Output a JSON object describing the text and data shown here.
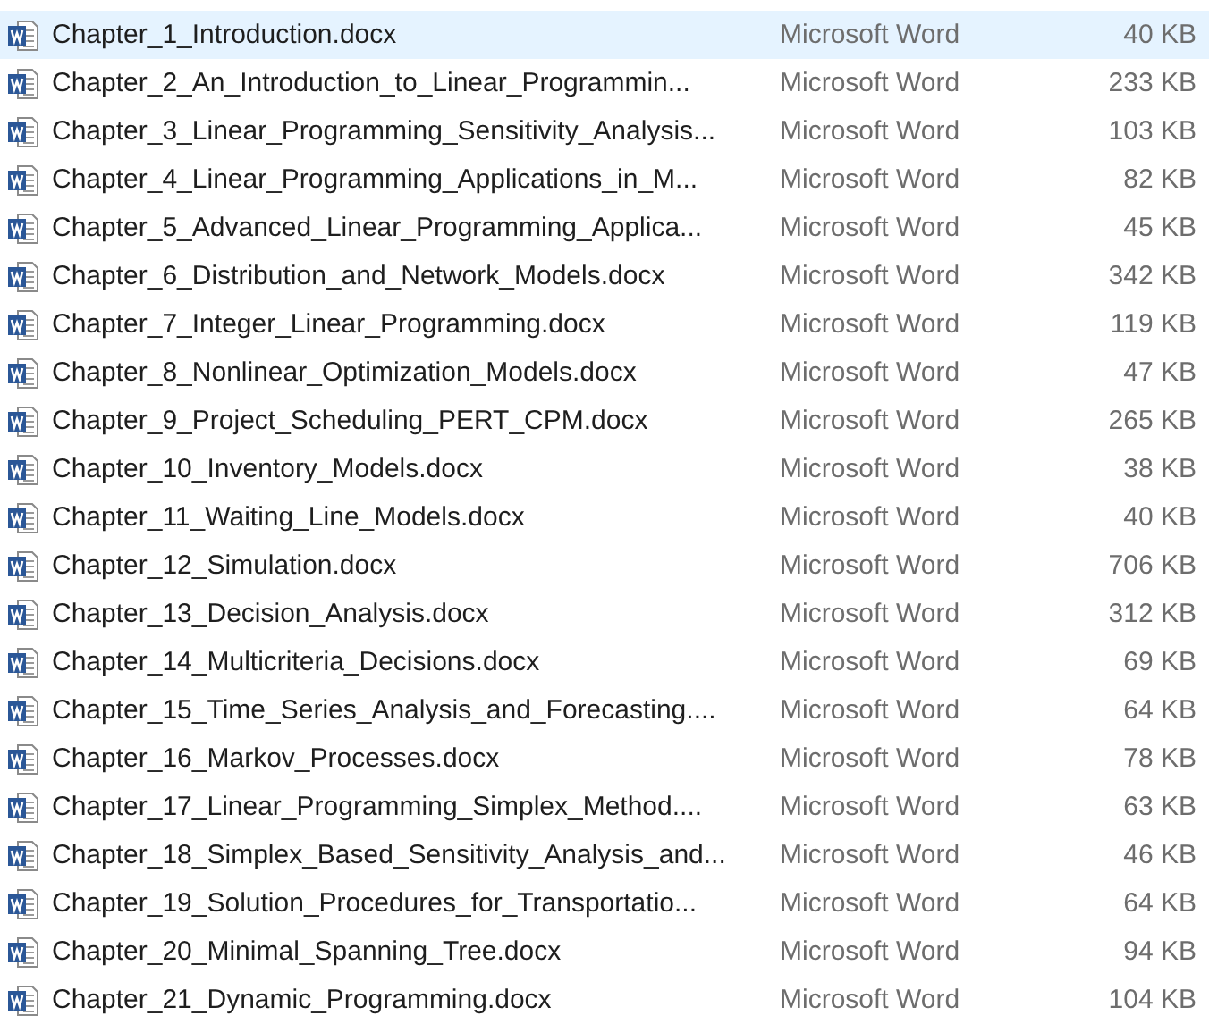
{
  "files": [
    {
      "name": "Chapter_1_Introduction.docx",
      "type": "Microsoft Word",
      "size": "40 KB",
      "selected": true
    },
    {
      "name": "Chapter_2_An_Introduction_to_Linear_Programmin...",
      "type": "Microsoft Word",
      "size": "233 KB",
      "selected": false
    },
    {
      "name": "Chapter_3_Linear_Programming_Sensitivity_Analysis...",
      "type": "Microsoft Word",
      "size": "103 KB",
      "selected": false
    },
    {
      "name": "Chapter_4_Linear_Programming_Applications_in_M...",
      "type": "Microsoft Word",
      "size": "82 KB",
      "selected": false
    },
    {
      "name": "Chapter_5_Advanced_Linear_Programming_Applica...",
      "type": "Microsoft Word",
      "size": "45 KB",
      "selected": false
    },
    {
      "name": "Chapter_6_Distribution_and_Network_Models.docx",
      "type": "Microsoft Word",
      "size": "342 KB",
      "selected": false
    },
    {
      "name": "Chapter_7_Integer_Linear_Programming.docx",
      "type": "Microsoft Word",
      "size": "119 KB",
      "selected": false
    },
    {
      "name": "Chapter_8_Nonlinear_Optimization_Models.docx",
      "type": "Microsoft Word",
      "size": "47 KB",
      "selected": false
    },
    {
      "name": "Chapter_9_Project_Scheduling_PERT_CPM.docx",
      "type": "Microsoft Word",
      "size": "265 KB",
      "selected": false
    },
    {
      "name": "Chapter_10_Inventory_Models.docx",
      "type": "Microsoft Word",
      "size": "38 KB",
      "selected": false
    },
    {
      "name": "Chapter_11_Waiting_Line_Models.docx",
      "type": "Microsoft Word",
      "size": "40 KB",
      "selected": false
    },
    {
      "name": "Chapter_12_Simulation.docx",
      "type": "Microsoft Word",
      "size": "706 KB",
      "selected": false
    },
    {
      "name": "Chapter_13_Decision_Analysis.docx",
      "type": "Microsoft Word",
      "size": "312 KB",
      "selected": false
    },
    {
      "name": "Chapter_14_Multicriteria_Decisions.docx",
      "type": "Microsoft Word",
      "size": "69 KB",
      "selected": false
    },
    {
      "name": "Chapter_15_Time_Series_Analysis_and_Forecasting....",
      "type": "Microsoft Word",
      "size": "64 KB",
      "selected": false
    },
    {
      "name": "Chapter_16_Markov_Processes.docx",
      "type": "Microsoft Word",
      "size": "78 KB",
      "selected": false
    },
    {
      "name": "Chapter_17_Linear_Programming_Simplex_Method....",
      "type": "Microsoft Word",
      "size": "63 KB",
      "selected": false
    },
    {
      "name": "Chapter_18_Simplex_Based_Sensitivity_Analysis_and...",
      "type": "Microsoft Word",
      "size": "46 KB",
      "selected": false
    },
    {
      "name": "Chapter_19_Solution_Procedures_for_Transportatio...",
      "type": "Microsoft Word",
      "size": "64 KB",
      "selected": false
    },
    {
      "name": "Chapter_20_Minimal_Spanning_Tree.docx",
      "type": "Microsoft Word",
      "size": "94 KB",
      "selected": false
    },
    {
      "name": "Chapter_21_Dynamic_Programming.docx",
      "type": "Microsoft Word",
      "size": "104 KB",
      "selected": false
    }
  ]
}
